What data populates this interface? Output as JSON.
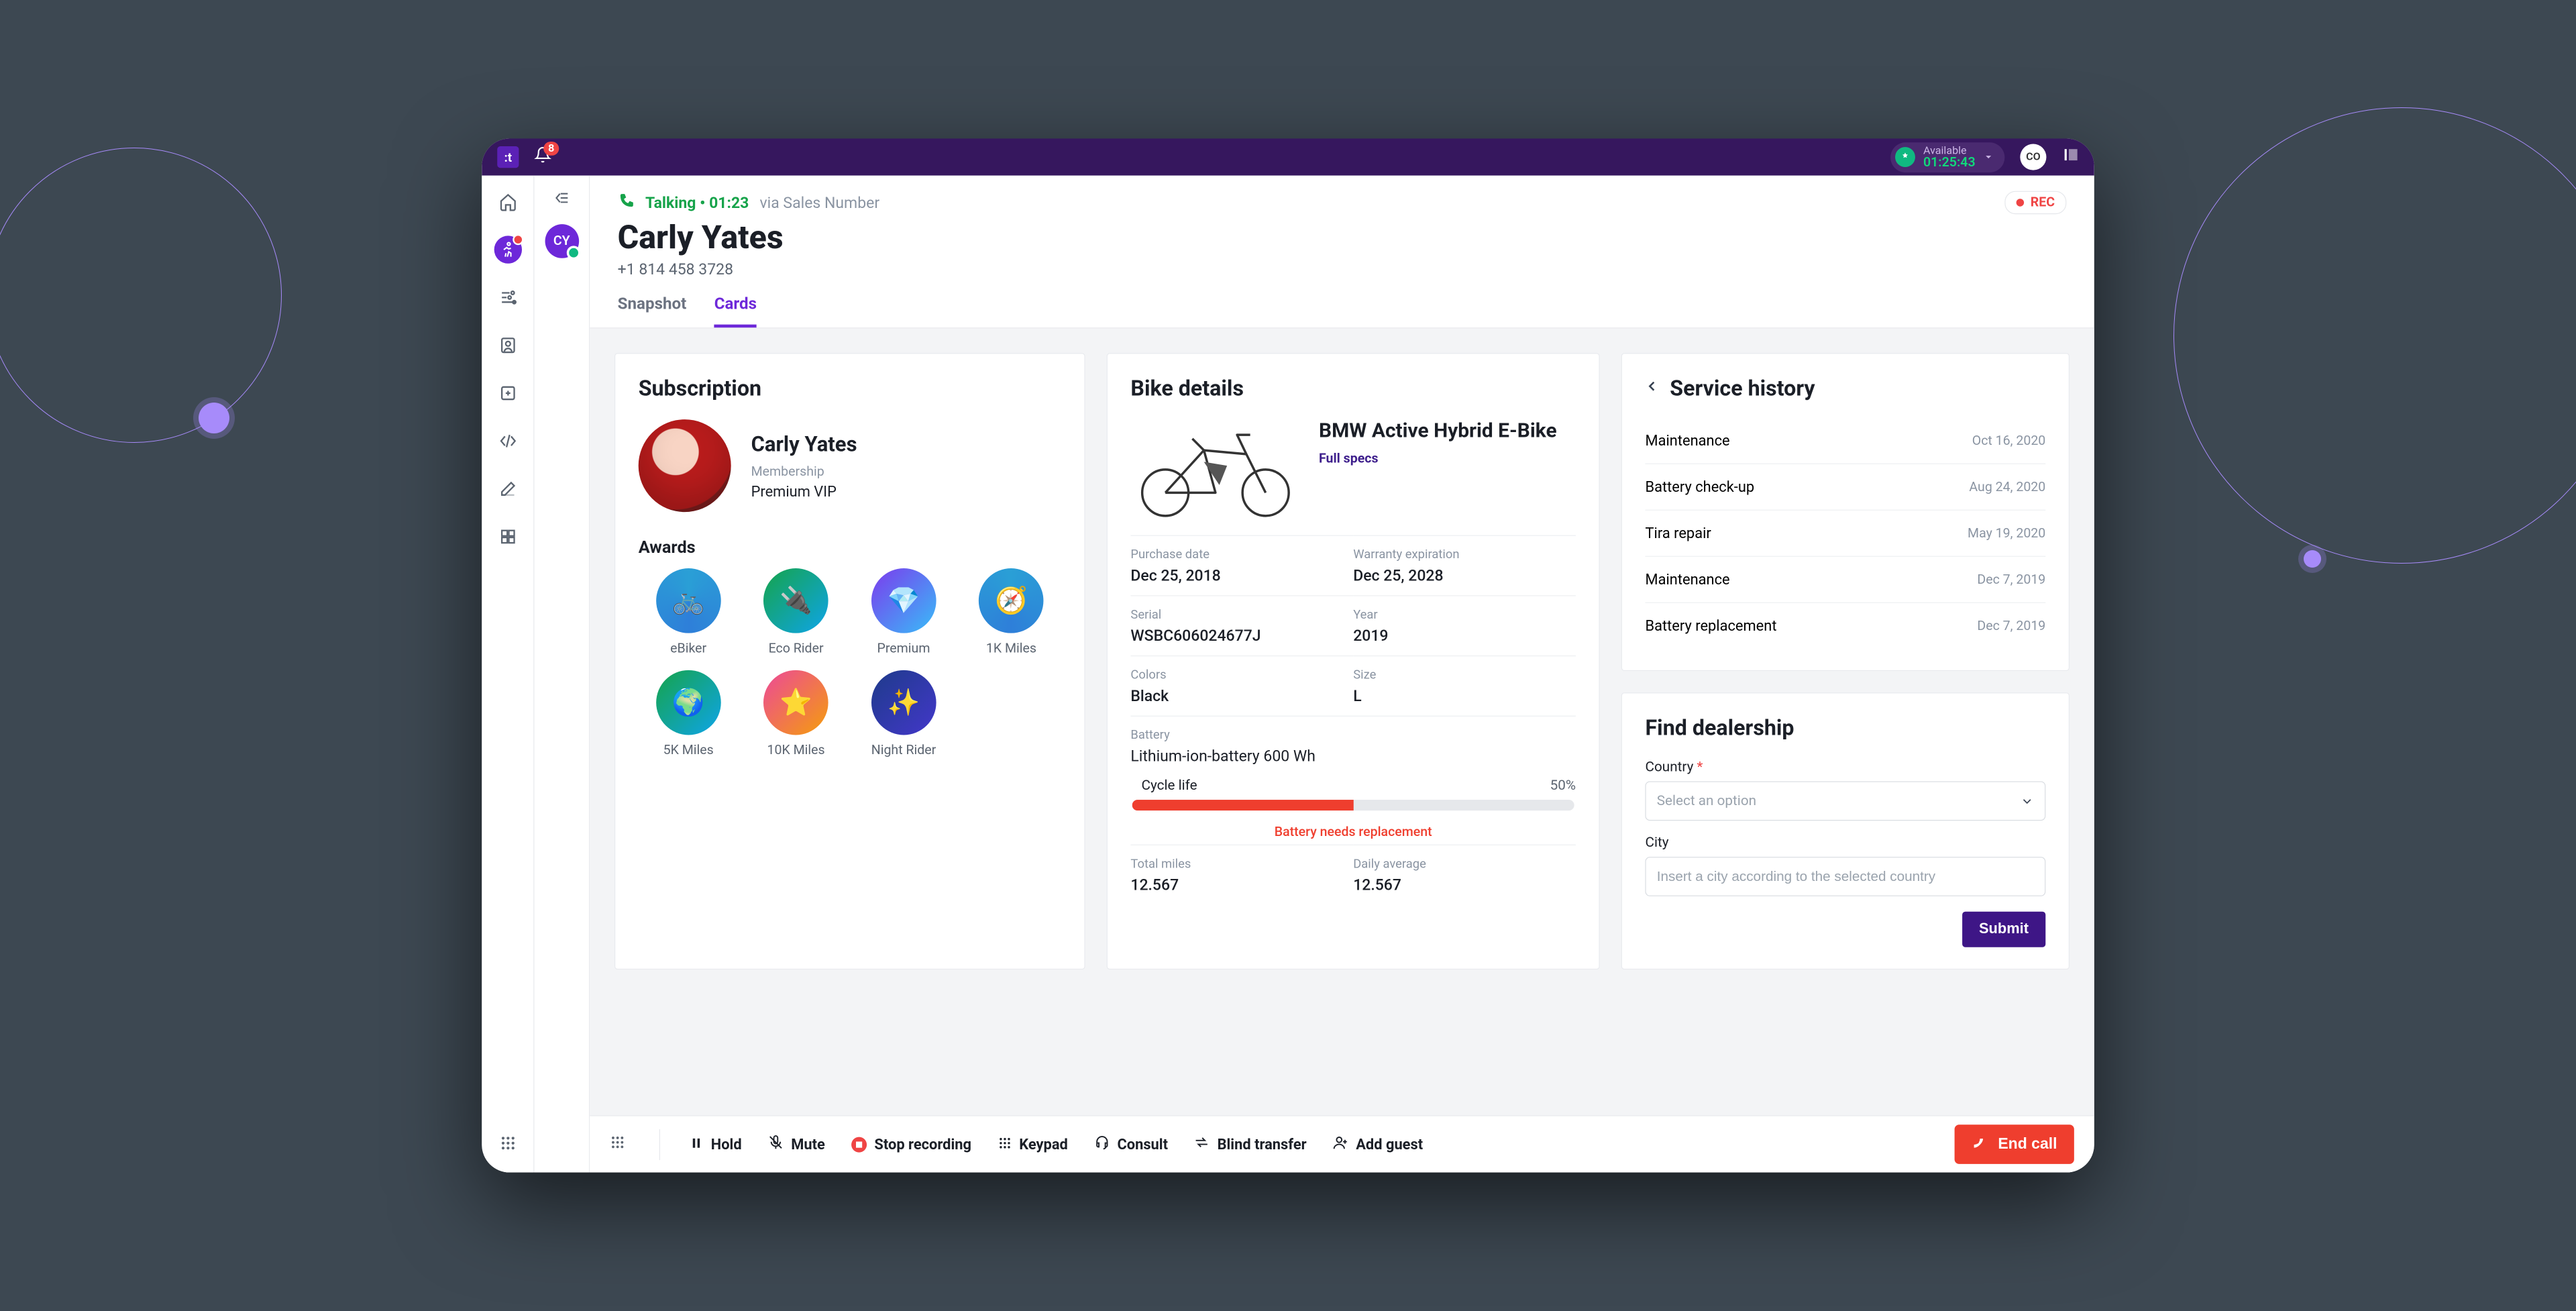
{
  "titlebar": {
    "notif_count": "8",
    "availability_label": "Available",
    "availability_timer": "01:25:43",
    "user_initials": "CO"
  },
  "context": {
    "customer_initials": "CY"
  },
  "header": {
    "status_text": "Talking • 01:23",
    "via_text": "via Sales Number",
    "rec_label": "REC",
    "customer_name": "Carly Yates",
    "customer_phone": "+1 814 458 3728"
  },
  "tabs": {
    "snapshot": "Snapshot",
    "cards": "Cards"
  },
  "subscription": {
    "title": "Subscription",
    "name": "Carly Yates",
    "membership_label": "Membership",
    "membership_value": "Premium VIP",
    "awards_title": "Awards",
    "awards": [
      {
        "label": "eBiker"
      },
      {
        "label": "Eco Rider"
      },
      {
        "label": "Premium"
      },
      {
        "label": "1K Miles"
      },
      {
        "label": "5K Miles"
      },
      {
        "label": "10K Miles"
      },
      {
        "label": "Night Rider"
      }
    ]
  },
  "bike": {
    "title": "Bike details",
    "name": "BMW Active Hybrid E-Bike",
    "full_specs": "Full specs",
    "fields": {
      "purchase_date_k": "Purchase date",
      "purchase_date_v": "Dec 25, 2018",
      "warranty_k": "Warranty expiration",
      "warranty_v": "Dec 25, 2028",
      "serial_k": "Serial",
      "serial_v": "WSBC606024677J",
      "year_k": "Year",
      "year_v": "2019",
      "colors_k": "Colors",
      "colors_v": "Black",
      "size_k": "Size",
      "size_v": "L",
      "battery_k": "Battery",
      "battery_v": "Lithium-ion-battery 600 Wh",
      "cycle_label": "Cycle life",
      "cycle_pct_text": "50%",
      "cycle_pct_num": 50,
      "warn": "Battery needs replacement",
      "total_miles_k": "Total miles",
      "total_miles_v": "12.567",
      "daily_avg_k": "Daily average",
      "daily_avg_v": "12.567"
    }
  },
  "service": {
    "title": "Service history",
    "rows": [
      {
        "n": "Maintenance",
        "d": "Oct 16, 2020"
      },
      {
        "n": "Battery check-up",
        "d": "Aug 24, 2020"
      },
      {
        "n": "Tira repair",
        "d": "May 19, 2020"
      },
      {
        "n": "Maintenance",
        "d": "Dec 7, 2019"
      },
      {
        "n": "Battery replacement",
        "d": "Dec 7, 2019"
      }
    ]
  },
  "dealer": {
    "title": "Find dealership",
    "country_label": "Country",
    "country_placeholder": "Select an option",
    "city_label": "City",
    "city_placeholder": "Insert a city according to the selected country",
    "submit": "Submit"
  },
  "footer": {
    "hold": "Hold",
    "mute": "Mute",
    "stop_rec": "Stop recording",
    "keypad": "Keypad",
    "consult": "Consult",
    "blind": "Blind transfer",
    "add_guest": "Add guest",
    "end_call": "End call"
  }
}
